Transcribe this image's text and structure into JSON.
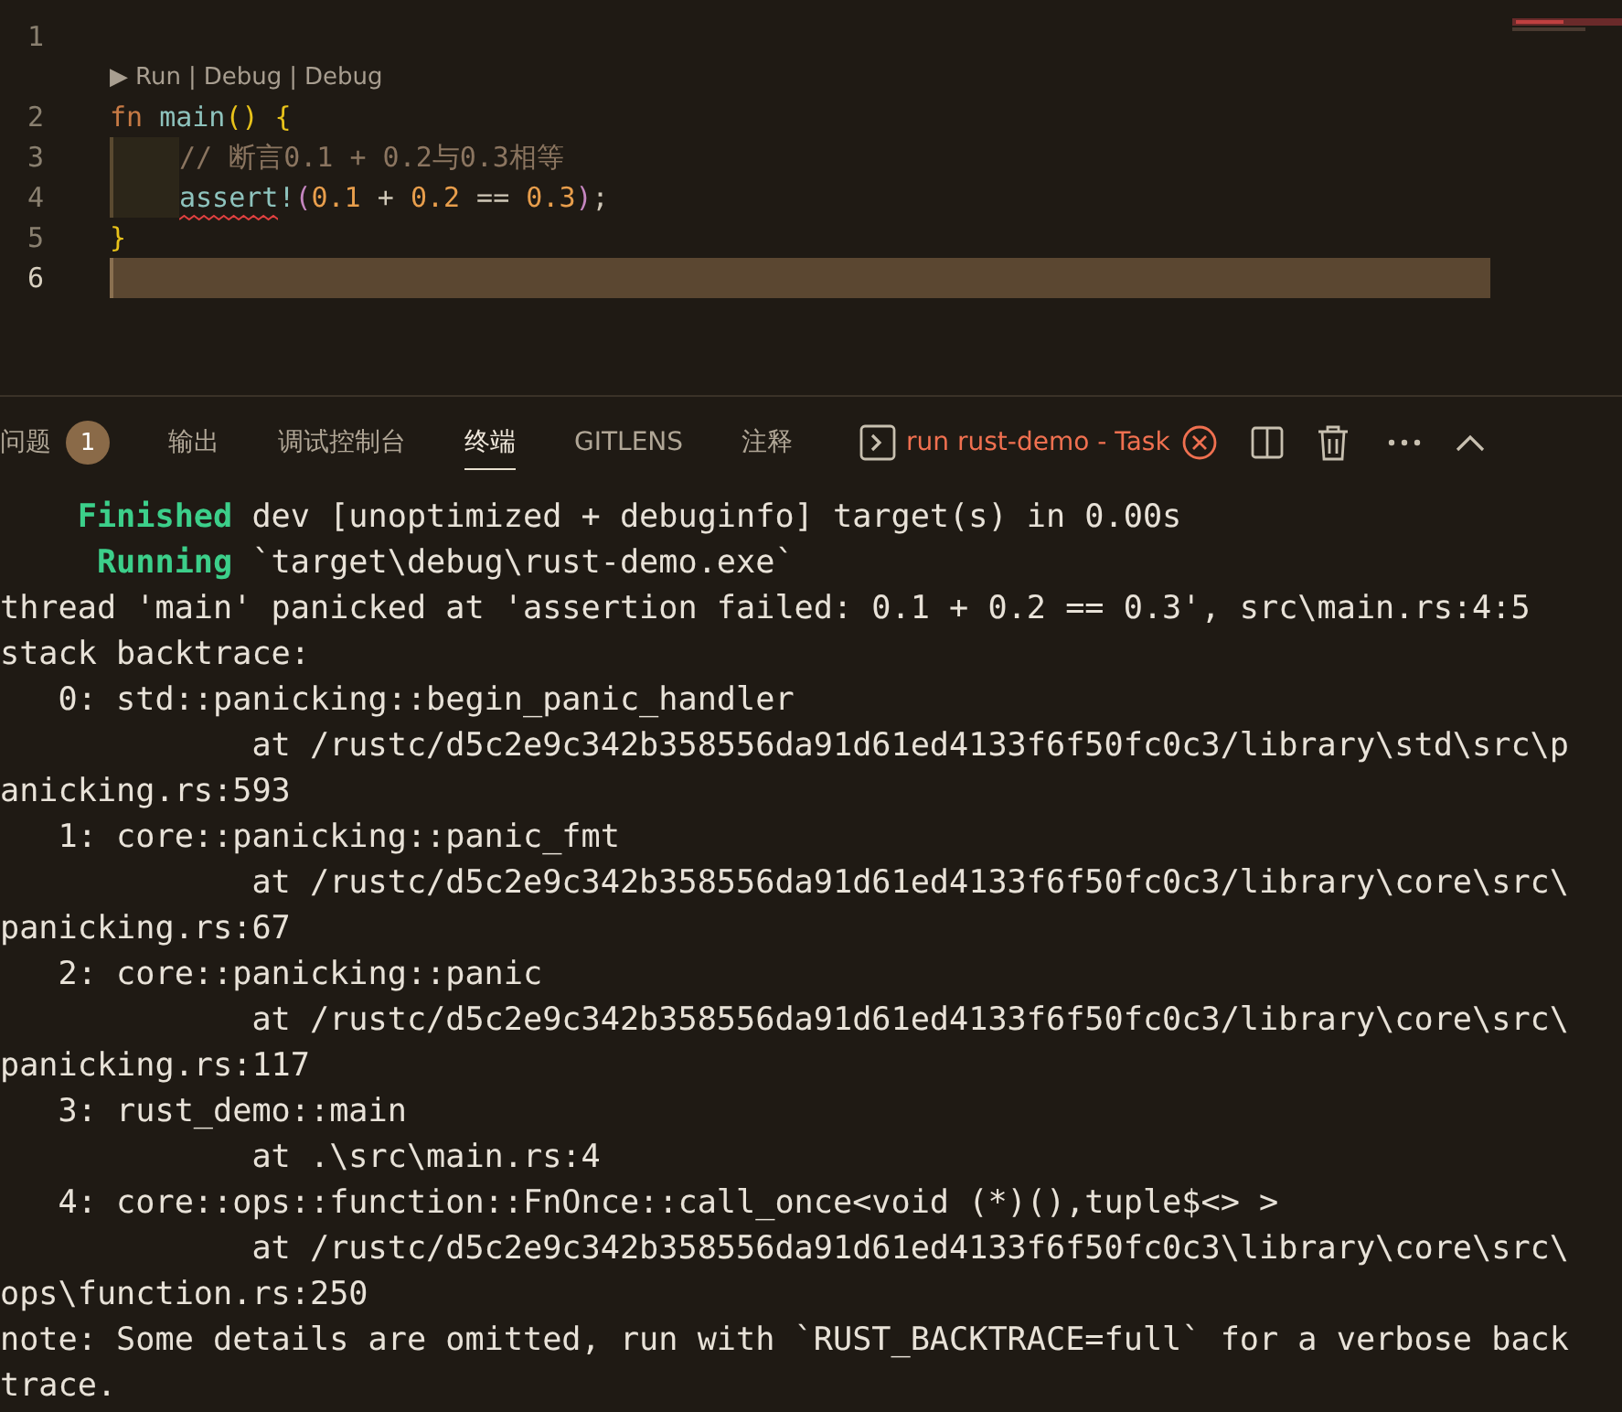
{
  "editor": {
    "lines": [
      {
        "number": "1",
        "current": false,
        "indent_guide": false
      },
      {
        "number": "2",
        "current": false,
        "indent_guide": false,
        "code_lens": {
          "arrow": "▶",
          "items": [
            "Run",
            "Debug",
            "Debug"
          ],
          "separator": "|"
        },
        "tokens": [
          {
            "text": "fn",
            "kind": "keyword"
          },
          {
            "text": "main",
            "kind": "function",
            "space_before": true
          },
          {
            "text": "()",
            "kind": "bracket"
          },
          {
            "text": "{",
            "kind": "bracket",
            "space_before": true
          }
        ]
      },
      {
        "number": "3",
        "current": false,
        "indent_guide": true,
        "tokens": [
          {
            "text": "// 断言0.1 + 0.2与0.3相等",
            "kind": "comment"
          }
        ]
      },
      {
        "number": "4",
        "current": false,
        "indent_guide": true,
        "tokens": [
          {
            "text": "assert",
            "kind": "macro",
            "error": true
          },
          {
            "text": "!",
            "kind": "macro"
          },
          {
            "text": "(",
            "kind": "paren"
          },
          {
            "text": "0.1",
            "kind": "number"
          },
          {
            "text": " + ",
            "kind": "operator"
          },
          {
            "text": "0.2",
            "kind": "number"
          },
          {
            "text": " == ",
            "kind": "operator"
          },
          {
            "text": "0.3",
            "kind": "number"
          },
          {
            "text": ")",
            "kind": "paren"
          },
          {
            "text": ";",
            "kind": "operator"
          }
        ]
      },
      {
        "number": "5",
        "current": false,
        "indent_guide": false,
        "tokens": [
          {
            "text": "}",
            "kind": "bracket"
          }
        ]
      },
      {
        "number": "6",
        "current": true,
        "indent_guide": false
      }
    ]
  },
  "panel": {
    "tabs": [
      {
        "label": "问题",
        "selected": false,
        "badge": "1"
      },
      {
        "label": "输出",
        "selected": false
      },
      {
        "label": "调试控制台",
        "selected": false
      },
      {
        "label": "终端",
        "selected": true
      },
      {
        "label": "GITLENS",
        "selected": false
      },
      {
        "label": "注释",
        "selected": false
      }
    ],
    "task": {
      "label": "run rust-demo - Task"
    }
  },
  "terminal": {
    "lines": [
      {
        "kind": "status",
        "label": "    Finished",
        "text": " dev [unoptimized + debuginfo] target(s) in 0.00s"
      },
      {
        "kind": "status",
        "label": "     Running",
        "text": " `target\\debug\\rust-demo.exe`"
      },
      {
        "kind": "plain",
        "text": "thread 'main' panicked at 'assertion failed: 0.1 + 0.2 == 0.3', src\\main.rs:4:5"
      },
      {
        "kind": "plain",
        "text": "stack backtrace:"
      },
      {
        "kind": "plain",
        "text": "   0: std::panicking::begin_panic_handler"
      },
      {
        "kind": "plain",
        "text": "             at /rustc/d5c2e9c342b358556da91d61ed4133f6f50fc0c3/library\\std\\src\\p"
      },
      {
        "kind": "plain",
        "text": "anicking.rs:593"
      },
      {
        "kind": "plain",
        "text": "   1: core::panicking::panic_fmt"
      },
      {
        "kind": "plain",
        "text": "             at /rustc/d5c2e9c342b358556da91d61ed4133f6f50fc0c3/library\\core\\src\\"
      },
      {
        "kind": "plain",
        "text": "panicking.rs:67"
      },
      {
        "kind": "plain",
        "text": "   2: core::panicking::panic"
      },
      {
        "kind": "plain",
        "text": "             at /rustc/d5c2e9c342b358556da91d61ed4133f6f50fc0c3/library\\core\\src\\"
      },
      {
        "kind": "plain",
        "text": "panicking.rs:117"
      },
      {
        "kind": "plain",
        "text": "   3: rust_demo::main"
      },
      {
        "kind": "plain",
        "text": "             at .\\src\\main.rs:4"
      },
      {
        "kind": "plain",
        "text": "   4: core::ops::function::FnOnce::call_once<void (*)(),tuple$<> >"
      },
      {
        "kind": "plain",
        "text": "             at /rustc/d5c2e9c342b358556da91d61ed4133f6f50fc0c3\\library\\core\\src\\"
      },
      {
        "kind": "plain",
        "text": "ops\\function.rs:250"
      },
      {
        "kind": "plain",
        "text": "note: Some details are omitted, run with `RUST_BACKTRACE=full` for a verbose back"
      },
      {
        "kind": "plain",
        "text": "trace."
      }
    ]
  }
}
